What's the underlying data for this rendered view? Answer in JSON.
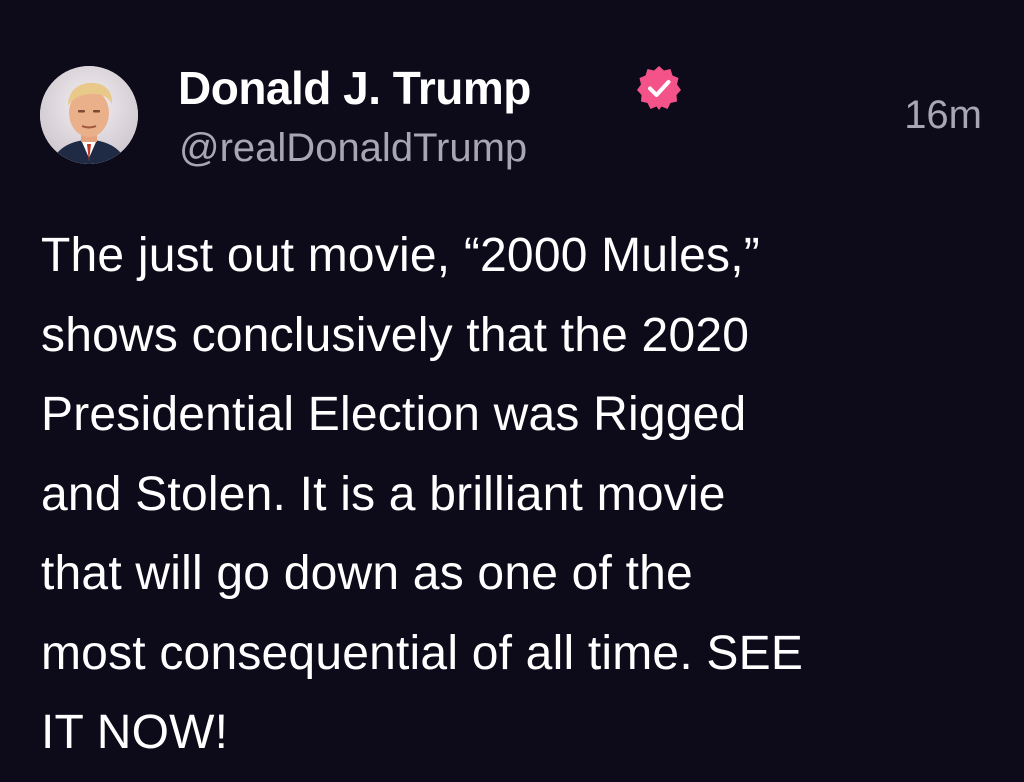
{
  "post": {
    "author": {
      "display_name": "Donald J. Trump",
      "handle": "@realDonaldTrump",
      "verified_icon": "verified-badge-icon",
      "verified_color": "#f4538a",
      "avatar_icon": "profile-photo"
    },
    "timestamp": "16m",
    "body_lines": [
      "The just out movie, “2000 Mules,”",
      "shows conclusively that the 2020",
      "Presidential Election was Rigged",
      "and Stolen. It is a brilliant movie",
      "that will go down as one of the",
      "most consequential of all time. SEE",
      "IT NOW!"
    ]
  },
  "colors": {
    "background": "#0d0a1a",
    "primary_text": "#ffffff",
    "secondary_text": "#a9a6b4"
  }
}
